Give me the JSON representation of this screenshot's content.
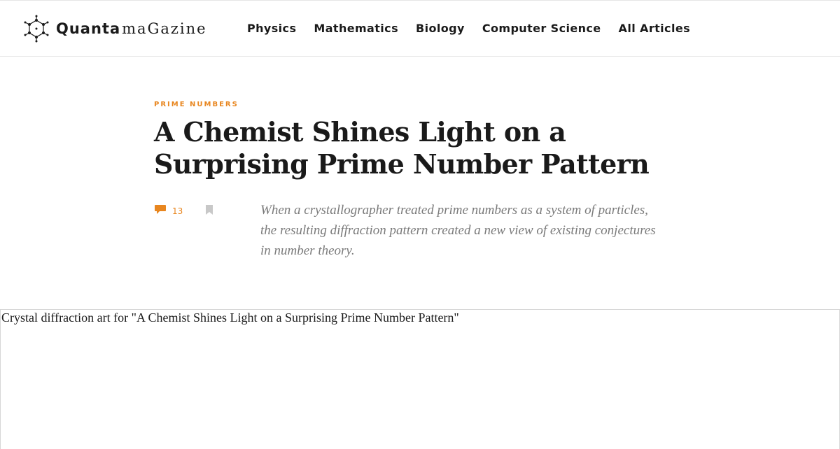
{
  "header": {
    "logo": {
      "brand": "Quanta",
      "suffix": "maGazine",
      "icon": "molecule-logo-icon"
    },
    "nav": [
      {
        "label": "Physics"
      },
      {
        "label": "Mathematics"
      },
      {
        "label": "Biology"
      },
      {
        "label": "Computer Science"
      },
      {
        "label": "All Articles"
      }
    ]
  },
  "article": {
    "kicker": "PRIME NUMBERS",
    "title": "A Chemist Shines Light on a Surprising Prime Number Pattern",
    "comments": {
      "count": "13",
      "icon": "comment-bubble-icon"
    },
    "bookmark": {
      "icon": "bookmark-icon"
    },
    "dek": "When a crystallographer treated prime numbers as a system of particles, the resulting diffraction pattern created a new view of existing conjectures in number theory.",
    "hero_alt": "Crystal diffraction art for \"A Chemist Shines Light on a Surprising Prime Number Pattern\""
  },
  "colors": {
    "accent": "#e8861f",
    "text": "#1a1a1a",
    "dek": "#7a7a7a",
    "bookmark": "#c8c8c8",
    "border": "#e6e6e6"
  }
}
